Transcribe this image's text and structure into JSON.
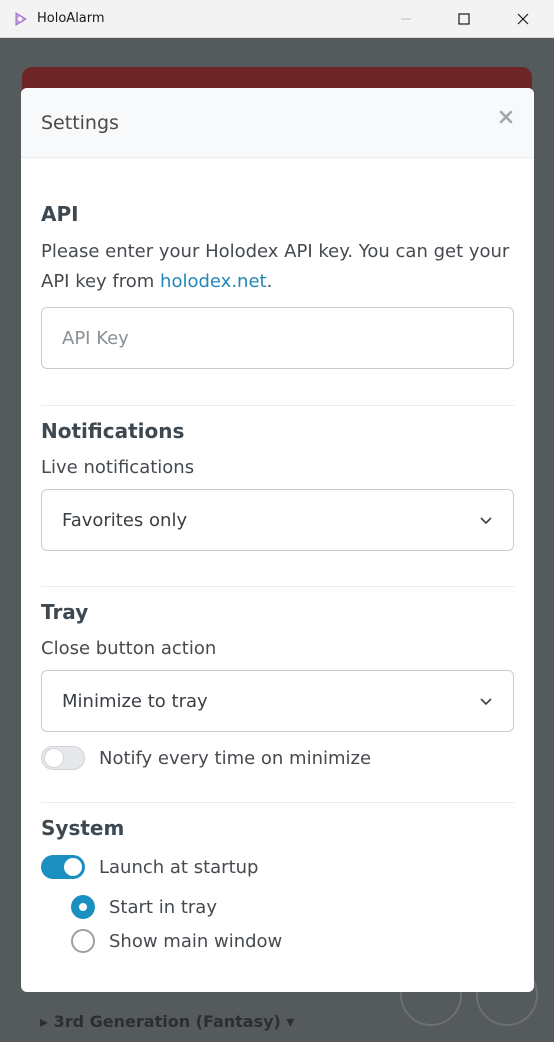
{
  "window": {
    "title": "HoloAlarm",
    "icon": "holoalarm-logo-icon"
  },
  "background": {
    "footer_text": "▸  3rd Generation (Fantasy)  ▾"
  },
  "modal": {
    "title": "Settings",
    "close_symbol": "✕",
    "api": {
      "title": "API",
      "desc_prefix": "Please enter your Holodex API key. You can get your API key from ",
      "link_text": "holodex.net",
      "desc_suffix": ".",
      "input_placeholder": "API Key",
      "input_value": ""
    },
    "notifications": {
      "title": "Notifications",
      "live_label": "Live notifications",
      "live_selected": "Favorites only"
    },
    "tray": {
      "title": "Tray",
      "close_label": "Close button action",
      "close_selected": "Minimize to tray",
      "notify_label": "Notify every time on minimize",
      "notify_enabled": false
    },
    "system": {
      "title": "System",
      "launch_label": "Launch at startup",
      "launch_enabled": true,
      "options": [
        {
          "label": "Start in tray",
          "checked": true
        },
        {
          "label": "Show main window",
          "checked": false
        }
      ]
    }
  },
  "colors": {
    "accent": "#1b8fc0",
    "link": "#2287b9",
    "overlay": "#555a5d"
  }
}
